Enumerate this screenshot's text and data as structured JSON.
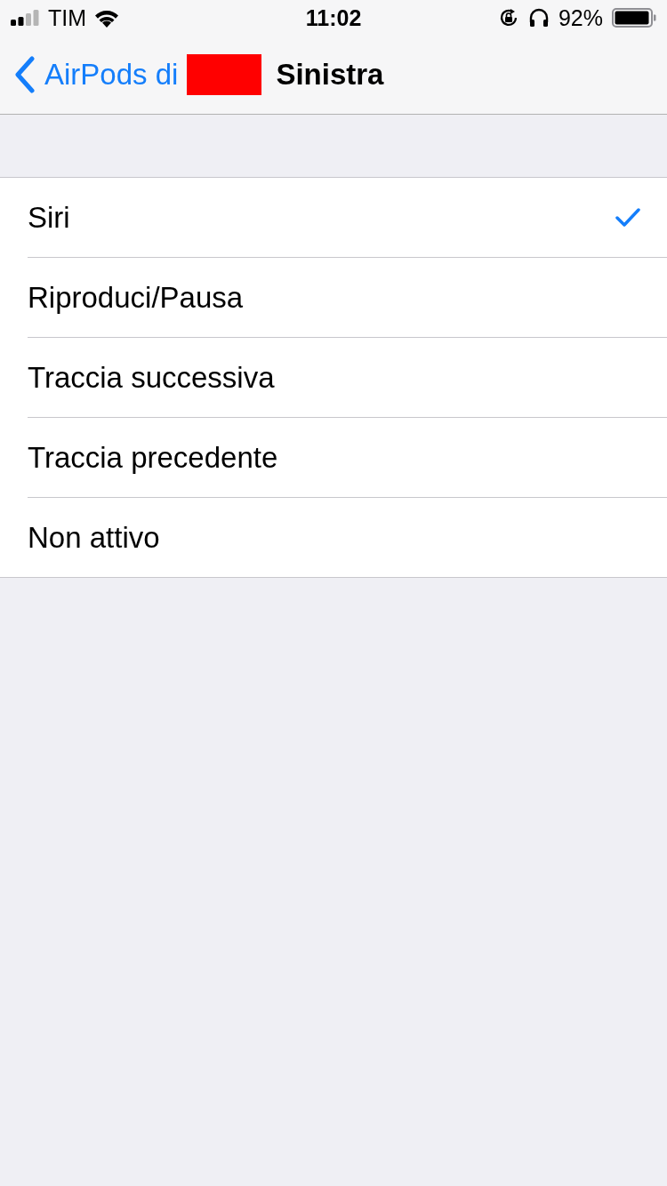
{
  "status_bar": {
    "carrier": "TIM",
    "time": "11:02",
    "battery": "92%"
  },
  "nav": {
    "back_label": "AirPods di",
    "title": "Sinistra"
  },
  "options": [
    {
      "label": "Siri",
      "selected": true
    },
    {
      "label": "Riproduci/Pausa",
      "selected": false
    },
    {
      "label": "Traccia successiva",
      "selected": false
    },
    {
      "label": "Traccia precedente",
      "selected": false
    },
    {
      "label": "Non attivo",
      "selected": false
    }
  ]
}
